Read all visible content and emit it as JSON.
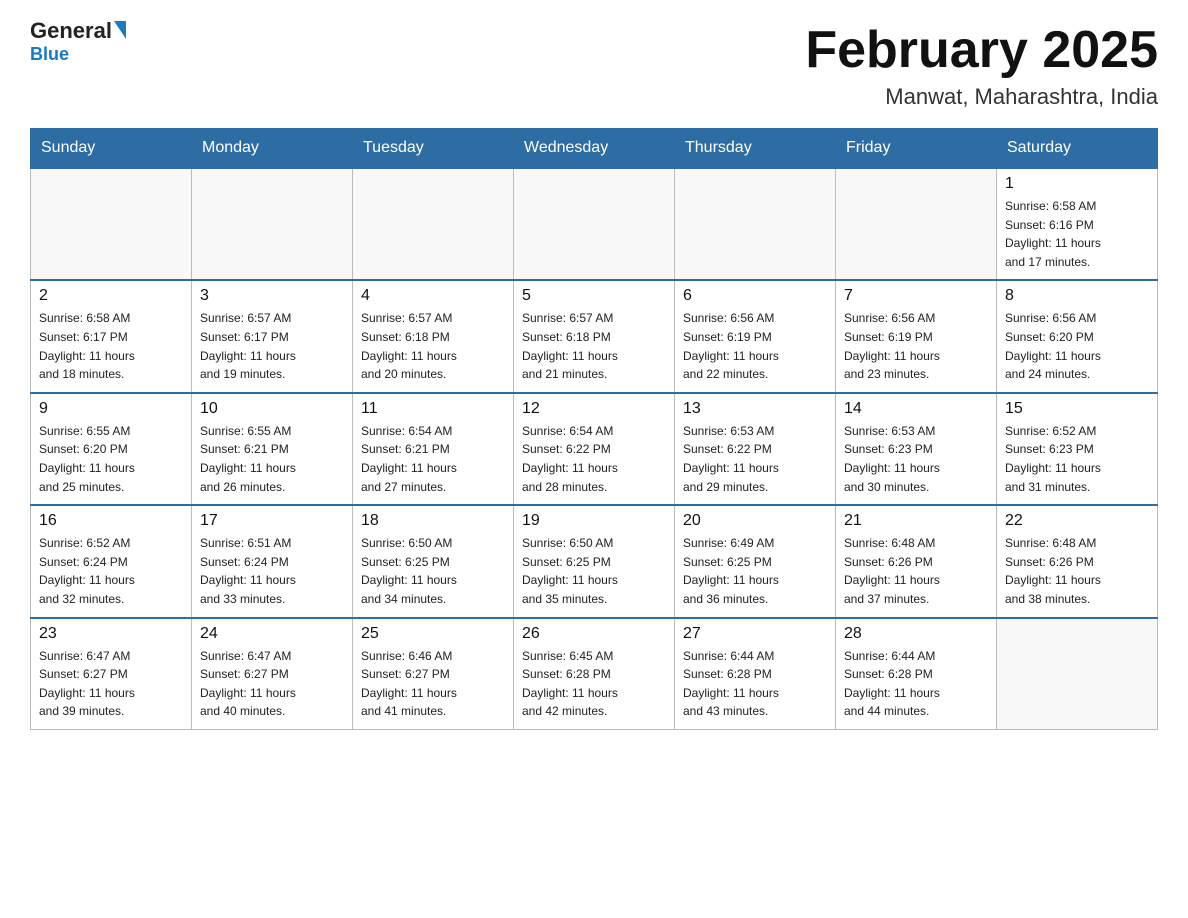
{
  "header": {
    "logo_general": "General",
    "logo_blue": "Blue",
    "month_title": "February 2025",
    "location": "Manwat, Maharashtra, India"
  },
  "weekdays": [
    "Sunday",
    "Monday",
    "Tuesday",
    "Wednesday",
    "Thursday",
    "Friday",
    "Saturday"
  ],
  "weeks": [
    [
      {
        "day": "",
        "info": ""
      },
      {
        "day": "",
        "info": ""
      },
      {
        "day": "",
        "info": ""
      },
      {
        "day": "",
        "info": ""
      },
      {
        "day": "",
        "info": ""
      },
      {
        "day": "",
        "info": ""
      },
      {
        "day": "1",
        "info": "Sunrise: 6:58 AM\nSunset: 6:16 PM\nDaylight: 11 hours\nand 17 minutes."
      }
    ],
    [
      {
        "day": "2",
        "info": "Sunrise: 6:58 AM\nSunset: 6:17 PM\nDaylight: 11 hours\nand 18 minutes."
      },
      {
        "day": "3",
        "info": "Sunrise: 6:57 AM\nSunset: 6:17 PM\nDaylight: 11 hours\nand 19 minutes."
      },
      {
        "day": "4",
        "info": "Sunrise: 6:57 AM\nSunset: 6:18 PM\nDaylight: 11 hours\nand 20 minutes."
      },
      {
        "day": "5",
        "info": "Sunrise: 6:57 AM\nSunset: 6:18 PM\nDaylight: 11 hours\nand 21 minutes."
      },
      {
        "day": "6",
        "info": "Sunrise: 6:56 AM\nSunset: 6:19 PM\nDaylight: 11 hours\nand 22 minutes."
      },
      {
        "day": "7",
        "info": "Sunrise: 6:56 AM\nSunset: 6:19 PM\nDaylight: 11 hours\nand 23 minutes."
      },
      {
        "day": "8",
        "info": "Sunrise: 6:56 AM\nSunset: 6:20 PM\nDaylight: 11 hours\nand 24 minutes."
      }
    ],
    [
      {
        "day": "9",
        "info": "Sunrise: 6:55 AM\nSunset: 6:20 PM\nDaylight: 11 hours\nand 25 minutes."
      },
      {
        "day": "10",
        "info": "Sunrise: 6:55 AM\nSunset: 6:21 PM\nDaylight: 11 hours\nand 26 minutes."
      },
      {
        "day": "11",
        "info": "Sunrise: 6:54 AM\nSunset: 6:21 PM\nDaylight: 11 hours\nand 27 minutes."
      },
      {
        "day": "12",
        "info": "Sunrise: 6:54 AM\nSunset: 6:22 PM\nDaylight: 11 hours\nand 28 minutes."
      },
      {
        "day": "13",
        "info": "Sunrise: 6:53 AM\nSunset: 6:22 PM\nDaylight: 11 hours\nand 29 minutes."
      },
      {
        "day": "14",
        "info": "Sunrise: 6:53 AM\nSunset: 6:23 PM\nDaylight: 11 hours\nand 30 minutes."
      },
      {
        "day": "15",
        "info": "Sunrise: 6:52 AM\nSunset: 6:23 PM\nDaylight: 11 hours\nand 31 minutes."
      }
    ],
    [
      {
        "day": "16",
        "info": "Sunrise: 6:52 AM\nSunset: 6:24 PM\nDaylight: 11 hours\nand 32 minutes."
      },
      {
        "day": "17",
        "info": "Sunrise: 6:51 AM\nSunset: 6:24 PM\nDaylight: 11 hours\nand 33 minutes."
      },
      {
        "day": "18",
        "info": "Sunrise: 6:50 AM\nSunset: 6:25 PM\nDaylight: 11 hours\nand 34 minutes."
      },
      {
        "day": "19",
        "info": "Sunrise: 6:50 AM\nSunset: 6:25 PM\nDaylight: 11 hours\nand 35 minutes."
      },
      {
        "day": "20",
        "info": "Sunrise: 6:49 AM\nSunset: 6:25 PM\nDaylight: 11 hours\nand 36 minutes."
      },
      {
        "day": "21",
        "info": "Sunrise: 6:48 AM\nSunset: 6:26 PM\nDaylight: 11 hours\nand 37 minutes."
      },
      {
        "day": "22",
        "info": "Sunrise: 6:48 AM\nSunset: 6:26 PM\nDaylight: 11 hours\nand 38 minutes."
      }
    ],
    [
      {
        "day": "23",
        "info": "Sunrise: 6:47 AM\nSunset: 6:27 PM\nDaylight: 11 hours\nand 39 minutes."
      },
      {
        "day": "24",
        "info": "Sunrise: 6:47 AM\nSunset: 6:27 PM\nDaylight: 11 hours\nand 40 minutes."
      },
      {
        "day": "25",
        "info": "Sunrise: 6:46 AM\nSunset: 6:27 PM\nDaylight: 11 hours\nand 41 minutes."
      },
      {
        "day": "26",
        "info": "Sunrise: 6:45 AM\nSunset: 6:28 PM\nDaylight: 11 hours\nand 42 minutes."
      },
      {
        "day": "27",
        "info": "Sunrise: 6:44 AM\nSunset: 6:28 PM\nDaylight: 11 hours\nand 43 minutes."
      },
      {
        "day": "28",
        "info": "Sunrise: 6:44 AM\nSunset: 6:28 PM\nDaylight: 11 hours\nand 44 minutes."
      },
      {
        "day": "",
        "info": ""
      }
    ]
  ]
}
